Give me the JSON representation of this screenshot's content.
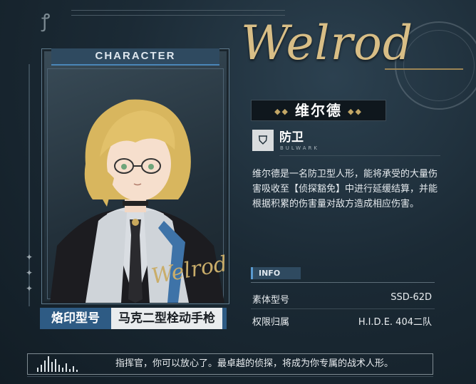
{
  "card": {
    "header": "CHARACTER",
    "signature": "Welrod"
  },
  "weapon": {
    "label": "烙印型号",
    "name": "马克二型栓动手枪"
  },
  "character": {
    "name_en": "Welrod",
    "name_cn": "维尔德",
    "role_cn": "防卫",
    "role_en": "BULWARK",
    "role_icon": "shield-icon",
    "description": "维尔德是一名防卫型人形，能将承受的大量伤害吸收至【侦探豁免】中进行延缓结算，并能根据积累的伤害量对敌方造成相应伤害。"
  },
  "info": {
    "tag": "INFO",
    "rows": [
      {
        "key": "素体型号",
        "value": "SSD-62D"
      },
      {
        "key": "权限归属",
        "value": "H.I.D.E. 404二队"
      }
    ]
  },
  "voice": {
    "text": "指挥官，你可以放心了。最卓越的侦探，将成为你专属的战术人形。"
  },
  "colors": {
    "accent_blue": "#2e5b84",
    "gold": "#d8be86",
    "background": "#1b2a35"
  }
}
